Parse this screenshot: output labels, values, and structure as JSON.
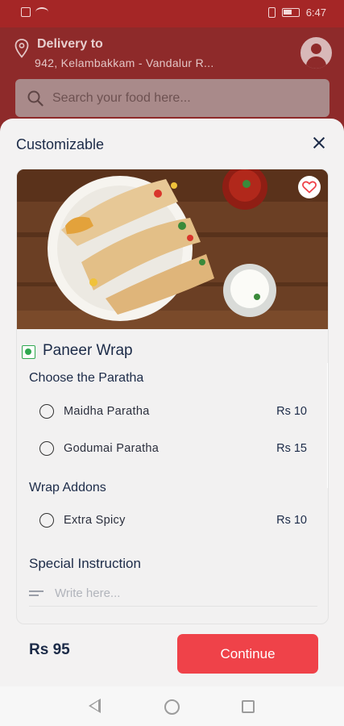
{
  "status_bar": {
    "time": "6:47"
  },
  "header": {
    "delivery_label": "Delivery to",
    "address": "942, Kelambakkam - Vandalur R..."
  },
  "search": {
    "placeholder": "Search your food here..."
  },
  "sheet": {
    "title": "Customizable",
    "item_name": "Paneer Wrap",
    "sections": [
      {
        "title": "Choose the Paratha",
        "options": [
          {
            "label": "Maidha Paratha",
            "price": "Rs 10"
          },
          {
            "label": "Godumai Paratha",
            "price": "Rs 15"
          }
        ]
      },
      {
        "title": "Wrap Addons",
        "options": [
          {
            "label": "Extra Spicy",
            "price": "Rs 10"
          }
        ]
      }
    ],
    "special_instruction": {
      "title": "Special Instruction",
      "placeholder": "Write here..."
    },
    "total": "Rs 95",
    "continue_label": "Continue"
  },
  "colors": {
    "brand": "#ef4249",
    "header_bg": "#8e2a2a",
    "text_dark": "#1c2b48",
    "veg_green": "#2fa84f"
  }
}
